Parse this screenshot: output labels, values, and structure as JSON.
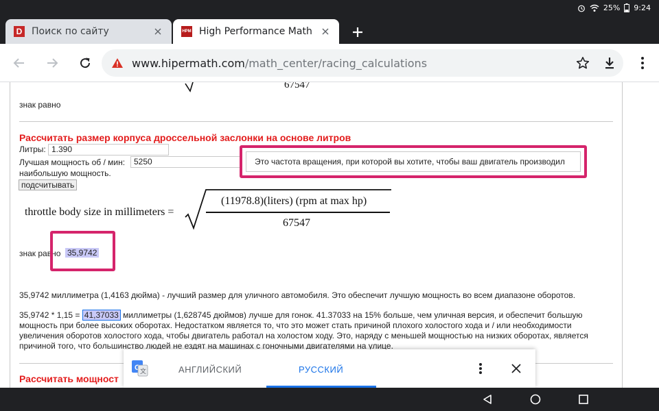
{
  "status": {
    "battery": "25%",
    "time": "9:24"
  },
  "tabs": [
    {
      "favicon": "D",
      "title": "Поиск по сайту",
      "active": false
    },
    {
      "favicon": "HPM",
      "title": "High Performance Math",
      "active": true
    }
  ],
  "toolbar": {
    "url_domain": "www.hipermath.com",
    "url_path": "/math_center/racing_calculations"
  },
  "page": {
    "top_formula_denominator": "67547",
    "top_equals_label": "знак равно",
    "section_title": "Рассчитать размер корпуса дроссельной заслонки на основе литров",
    "liters_label": "Литры:",
    "liters_value": "1.390",
    "rpm_label": "Лучшая мощность об / мин:",
    "rpm_value": "5250",
    "rpm_label_wrap": "наибольшую мощность.",
    "tooltip": "Это частота вращения, при которой вы хотите, чтобы ваш двигатель производил",
    "calc_button": "подсчитывать",
    "formula_lhs": "throttle body size in millimeters =",
    "formula_numerator": "(11978.8)(liters) (rpm at max hp)",
    "formula_denominator": "67547",
    "equals_label": "знак равно",
    "result_value": "35,9742",
    "para1": "35,9742 миллиметра (1,4163 дюйма) - лучший размер для уличного автомобиля. Это обеспечит лучшую мощность во всем диапазоне оборотов.",
    "para2_prefix": "35,9742 * 1,15 =",
    "para2_value": "41,37033",
    "para2_line1_rest": "миллиметры (1,628745 дюймов) лучше для гонок. 41.37033 на 15% больше, чем уличная версия, и обеспечит большую",
    "para2_line2": "мощность при более высоких оборотах. Недостатком является то, что это может стать причиной плохого холостого хода и / или необходимости",
    "para2_line3": "увеличения оборотов холостого хода, чтобы двигатель работал на холостом ходу. Это, наряду с меньшей мощностью на низких оборотах, является",
    "para2_line4": "причиной того, что большинство людей не ездят на машинах с гоночными двигателями на улице.",
    "next_section_title": "Рассчитать мощност"
  },
  "translate": {
    "lang_source": "АНГЛИЙСКИЙ",
    "lang_target": "РУССКИЙ"
  },
  "colors": {
    "accent": "#1a73e8",
    "section_title": "#e31c1c",
    "highlight": "#c9c9f7",
    "annotation": "#d5246b",
    "warning": "#d93025"
  }
}
